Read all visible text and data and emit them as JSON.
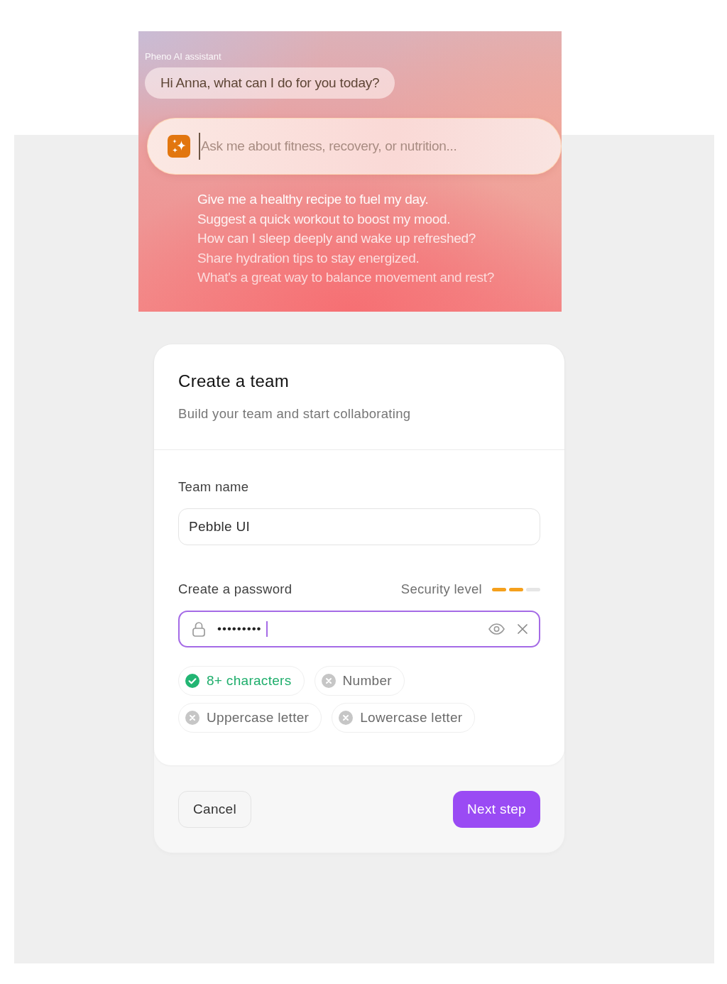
{
  "assistant": {
    "label": "Pheno AI assistant",
    "greeting": "Hi Anna, what can I do for you today?",
    "prompt": {
      "placeholder": "Ask me about fitness, recovery, or nutrition..."
    },
    "suggestions": [
      "Give me a healthy recipe to fuel my day.",
      "Suggest a quick workout to boost my mood.",
      "How can I sleep deeply and wake up refreshed?",
      "Share hydration tips to stay energized.",
      "What's a great way to balance movement and rest?"
    ]
  },
  "dialog": {
    "title": "Create a team",
    "subtitle": "Build your team and start collaborating",
    "team_name": {
      "label": "Team name",
      "value": "Pebble UI"
    },
    "password": {
      "label": "Create a password",
      "value": "•••••••••",
      "focused": true,
      "security": {
        "label": "Security level",
        "segments": [
          {
            "filled": true
          },
          {
            "filled": true
          },
          {
            "filled": false
          }
        ]
      },
      "requirements": [
        {
          "label": "8+ characters",
          "met": true
        },
        {
          "label": "Number",
          "met": false
        },
        {
          "label": "Uppercase letter",
          "met": false
        },
        {
          "label": "Lowercase letter",
          "met": false
        }
      ]
    },
    "buttons": {
      "cancel": "Cancel",
      "next": "Next step"
    }
  }
}
